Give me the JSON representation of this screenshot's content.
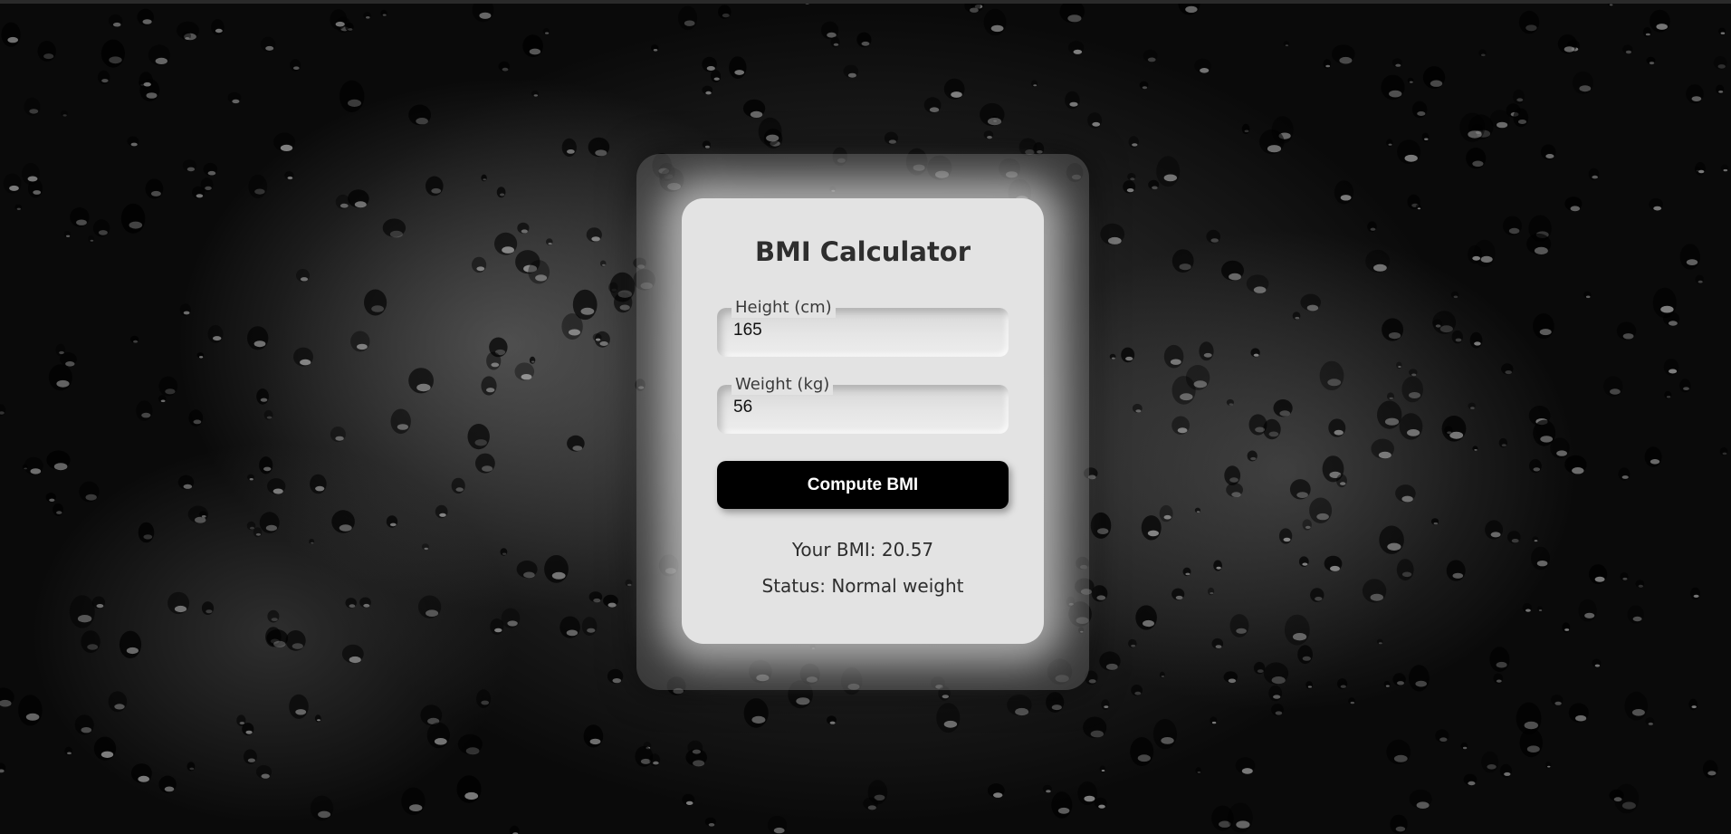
{
  "calculator": {
    "title": "BMI Calculator",
    "height_label": "Height (cm)",
    "height_value": "165",
    "weight_label": "Weight (kg)",
    "weight_value": "56",
    "compute_label": "Compute BMI",
    "bmi_result": "Your BMI: 20.57",
    "status_result": "Status: Normal weight"
  },
  "colors": {
    "card_background": "#e3e3e3",
    "button_background": "#000000",
    "button_text": "#ffffff",
    "text": "#2e2e2e"
  }
}
